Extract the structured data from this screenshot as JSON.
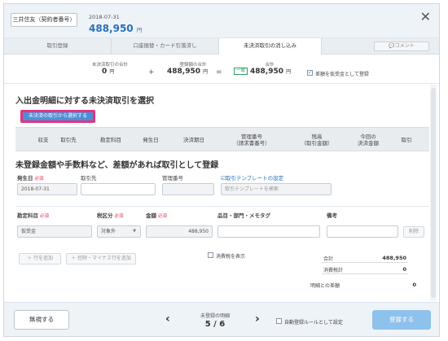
{
  "header": {
    "account_label": "三井住友（契約者番号）",
    "date": "2018-07-31",
    "amount": "488,950",
    "amount_unit": "円"
  },
  "tabs": [
    {
      "label": "取引登録",
      "active": false
    },
    {
      "label": "口座振替・カード引落済し",
      "active": false
    },
    {
      "label": "未決済取引の消し込み",
      "active": true
    }
  ],
  "comment_button": "コメント",
  "summary": {
    "unsettled_label": "未決済取引の合計",
    "unsettled_value": "0",
    "unsettled_unit": "円",
    "plus": "+",
    "registered_label": "登録額の合計",
    "registered_value": "488,950",
    "registered_unit": "円",
    "equals": "=",
    "total_label": "合計",
    "match_badge": "一致",
    "total_value": "488,950",
    "total_unit": "円",
    "checkbox_label": "差額を仮受金として登録",
    "checkbox_checked": true
  },
  "section1": {
    "title": "入出金明細に対する未決済取引を選択",
    "select_button": "未決済の取引から選択する",
    "columns": [
      "収支",
      "取引先",
      "勘定科目",
      "発生日",
      "決済期日",
      "管理番号\n（請求書番号）",
      "残高\n（取引金額）",
      "今回の\n決済金額",
      "取引"
    ]
  },
  "section2": {
    "title": "未登録金額や手数料など、差額があれば取引として登録",
    "date_label": "発生日",
    "required": "必須",
    "partner_label": "取引先",
    "mgmt_label": "管理番号",
    "template_link": "取引テンプレートの設定",
    "date_value": "2018-07-31",
    "template_placeholder": "取引テンプレートを検索",
    "account_label": "勘定科目",
    "tax_label": "税区分",
    "amount_label": "金額",
    "item_label": "品目・部門・メモタグ",
    "note_label": "備考",
    "account_value": "仮受金",
    "tax_value": "対象外",
    "amount_value": "488,950",
    "delete_button": "削除",
    "add_row_button": "＋ 行を追加",
    "add_adjust_button": "＋ 控除・マイナス行を追加",
    "tax_show_label": "消費税を表示",
    "total_label": "合計",
    "total_value": "488,950",
    "tax_total_label": "消費税計",
    "tax_total_value": "0",
    "diff_label": "明細との差額",
    "diff_value": "0"
  },
  "footer": {
    "ignore_button": "無視する",
    "prev": "‹",
    "next": "›",
    "unreg_label": "未登録の明細",
    "page": "5 / 6",
    "auto_rule_label": "自動登録ルールとして設定",
    "register_button": "登録する"
  },
  "colors": {
    "accent": "#2a6fb8",
    "highlight": "#e8327a",
    "primary_button": "#8ec1ec",
    "required": "#e0344d"
  }
}
